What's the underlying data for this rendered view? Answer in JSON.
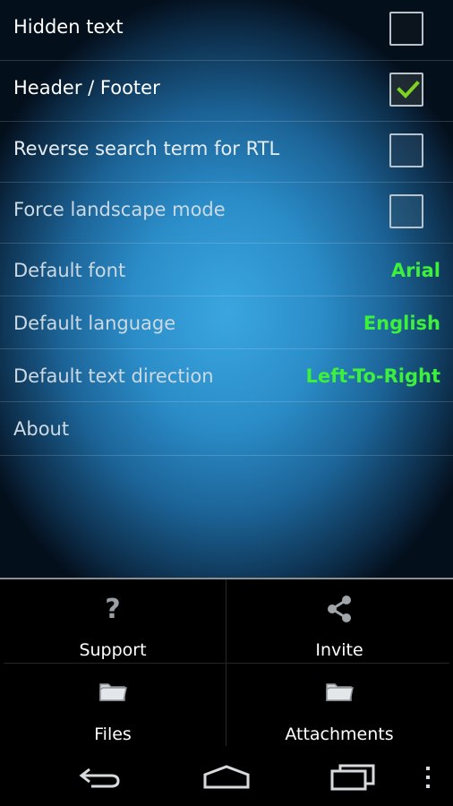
{
  "settings": {
    "hidden_text": {
      "label": "Hidden text",
      "checked": false
    },
    "header_footer": {
      "label": "Header / Footer",
      "checked": true
    },
    "reverse_search": {
      "label": "Reverse search term for RTL",
      "checked": false
    },
    "force_landscape": {
      "label": "Force landscape mode",
      "checked": false
    },
    "default_font": {
      "label": "Default font",
      "value": "Arial"
    },
    "default_language": {
      "label": "Default language",
      "value": "English"
    },
    "default_direction": {
      "label": "Default text direction",
      "value": "Left-To-Right"
    },
    "about": {
      "label": "About"
    }
  },
  "actions": {
    "support": {
      "label": "Support",
      "glyph": "?",
      "icon": "question-icon"
    },
    "invite": {
      "label": "Invite",
      "icon": "share-icon"
    },
    "files": {
      "label": "Files",
      "icon": "folder-icon"
    },
    "attachments": {
      "label": "Attachments",
      "icon": "folder-icon"
    }
  },
  "navbar": {
    "back": "back-icon",
    "home": "home-icon",
    "recents": "recents-icon",
    "menu": "overflow-menu-icon"
  },
  "colors": {
    "value_green": "#3cf03c",
    "panel_background": "#000000",
    "settings_gradient_center": "#3aa6e0"
  }
}
